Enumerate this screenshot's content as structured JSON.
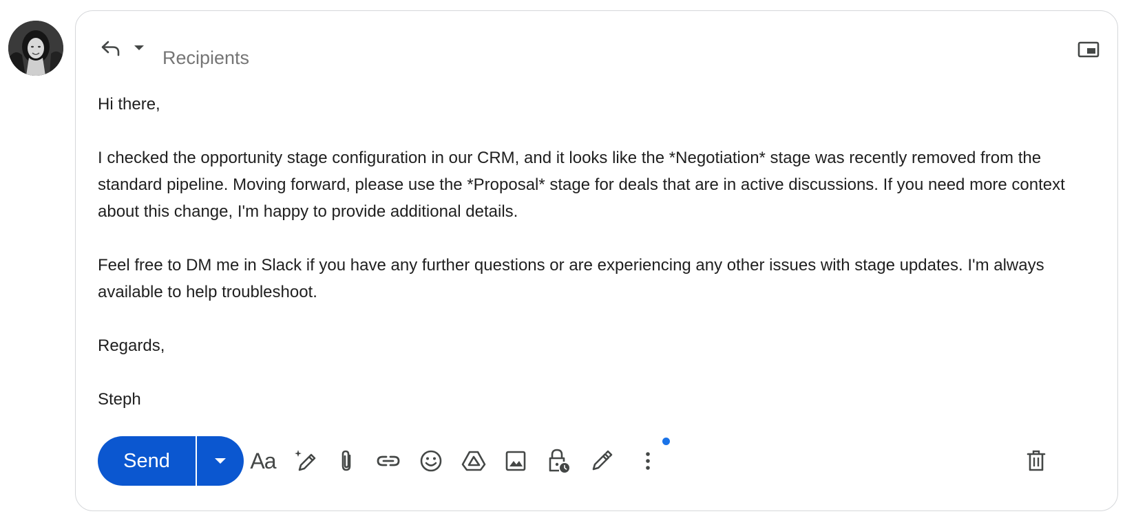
{
  "header": {
    "recipients_placeholder": "Recipients",
    "reply_icon": "reply-icon",
    "caret_icon": "chevron-down-icon",
    "popout_icon": "popout-icon"
  },
  "body": {
    "greeting": "Hi there,",
    "paragraph1": "I checked the opportunity stage configuration in our CRM, and it looks like the *Negotiation* stage was recently removed from the standard pipeline. Moving forward, please use the *Proposal* stage for deals that are in active discussions. If you need more context about this change, I'm happy to provide additional details.",
    "paragraph2": "Feel free to DM me in Slack if you have any further questions or are experiencing any other issues with stage updates. I'm always available to help troubleshoot.",
    "closing": "Regards,",
    "signature": "Steph"
  },
  "toolbar": {
    "send_label": "Send",
    "formatting_label": "Aa",
    "icons": [
      "send-options-icon",
      "formatting-icon",
      "help-me-write-icon",
      "attach-icon",
      "link-icon",
      "emoji-icon",
      "drive-icon",
      "image-icon",
      "confidential-icon",
      "signature-icon",
      "more-options-icon",
      "delete-icon"
    ]
  },
  "colors": {
    "send_button": "#0b57d0",
    "notification_dot": "#1a73e8",
    "icon": "#444746",
    "border": "#d5d7da"
  }
}
